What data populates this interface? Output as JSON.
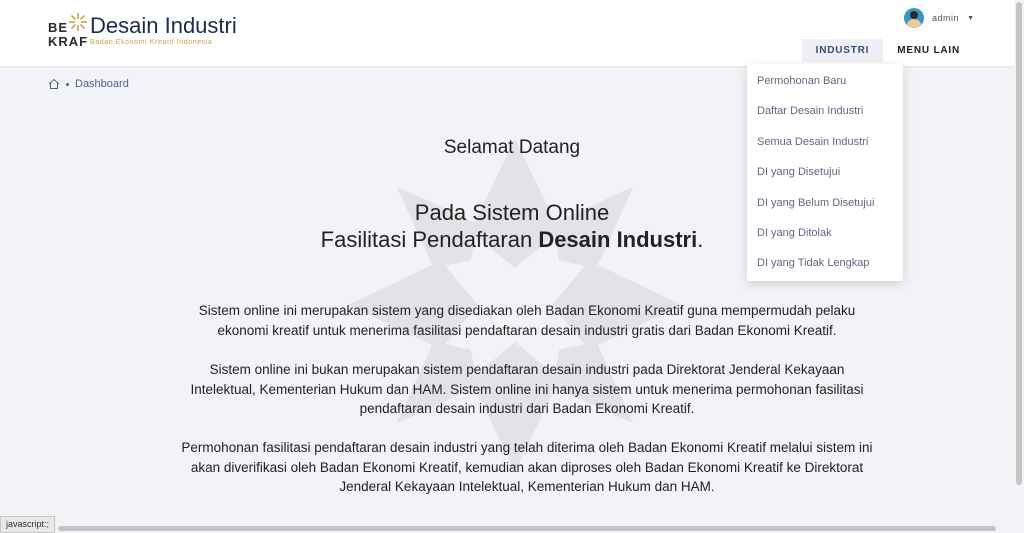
{
  "brand": {
    "logo_line1": "BE",
    "logo_line2": "KRAF",
    "title": "Desain Industri",
    "subtitle": "Badan Ekonomi Kreatif Indonesia"
  },
  "user": {
    "name": "admin"
  },
  "nav": [
    {
      "label": "INDUSTRI",
      "active": true
    },
    {
      "label": "MENU LAIN",
      "active": false
    }
  ],
  "breadcrumb": {
    "current": "Dashboard"
  },
  "dropdown": {
    "items": [
      "Permohonan Baru",
      "Daftar Desain Industri",
      "Semua Desain Industri",
      "DI yang Disetujui",
      "DI yang Belum Disetujui",
      "DI yang Ditolak",
      "DI yang Tidak Lengkap"
    ]
  },
  "main": {
    "welcome": "Selamat Datang",
    "headline_line1": "Pada Sistem Online",
    "headline_line2_prefix": "Fasilitasi Pendaftaran ",
    "headline_line2_bold": "Desain Industri",
    "headline_line2_suffix": ".",
    "paragraphs": [
      "Sistem online ini merupakan sistem yang disediakan oleh Badan Ekonomi Kreatif guna mempermudah pelaku ekonomi kreatif untuk menerima fasilitasi pendaftaran desain industri gratis dari Badan Ekonomi Kreatif.",
      "Sistem online ini bukan merupakan sistem pendaftaran desain industri pada Direktorat Jenderal Kekayaan Intelektual, Kementerian Hukum dan HAM. Sistem online ini hanya sistem untuk menerima permohonan fasilitasi pendaftaran desain industri dari Badan Ekonomi Kreatif.",
      "Permohonan fasilitasi pendaftaran desain industri yang telah diterima oleh Badan Ekonomi Kreatif melalui sistem ini akan diverifikasi oleh Badan Ekonomi Kreatif, kemudian akan diproses oleh Badan Ekonomi Kreatif ke Direktorat Jenderal Kekayaan Intelektual, Kementerian Hukum dan HAM."
    ]
  },
  "status_bar": {
    "text": "javascript:;"
  },
  "colors": {
    "brand_navy": "#1c2a50",
    "brand_gold": "#c9a24a",
    "menu_text": "#606880"
  }
}
